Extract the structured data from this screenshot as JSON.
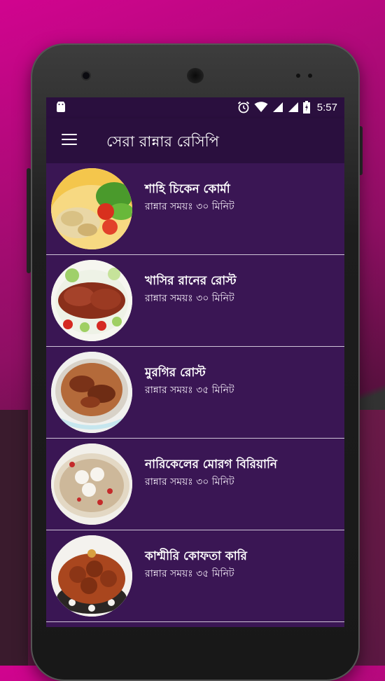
{
  "status_bar": {
    "time": "5:57",
    "icons": [
      "android-icon",
      "alarm-icon",
      "wifi-icon",
      "signal-icon",
      "signal-icon",
      "battery-icon"
    ]
  },
  "app_bar": {
    "title": "সেরা রান্নার রেসিপি",
    "menu_icon": "hamburger-menu-icon"
  },
  "recipes": [
    {
      "name": "শাহি চিকেন কোর্মা",
      "time": "রান্নার সময়ঃ ৩০ মিনিট"
    },
    {
      "name": "খাসির রানের রোস্ট",
      "time": "রান্নার সময়ঃ ৩০ মিনিট"
    },
    {
      "name": "মুরগির রোস্ট",
      "time": "রান্নার সময়ঃ ৩৫ মিনিট"
    },
    {
      "name": "নারিকেলের মোরগ বিরিয়ানি",
      "time": "রান্নার সময়ঃ ৩০ মিনিট"
    },
    {
      "name": "কাশ্মীরি কোফতা কারি",
      "time": "রান্নার সময়ঃ ৩৫ মিনিট"
    }
  ],
  "colors": {
    "app_bar": "#2a0f3e",
    "list_background": "#3a1654",
    "divider": "#cfc4d8"
  }
}
